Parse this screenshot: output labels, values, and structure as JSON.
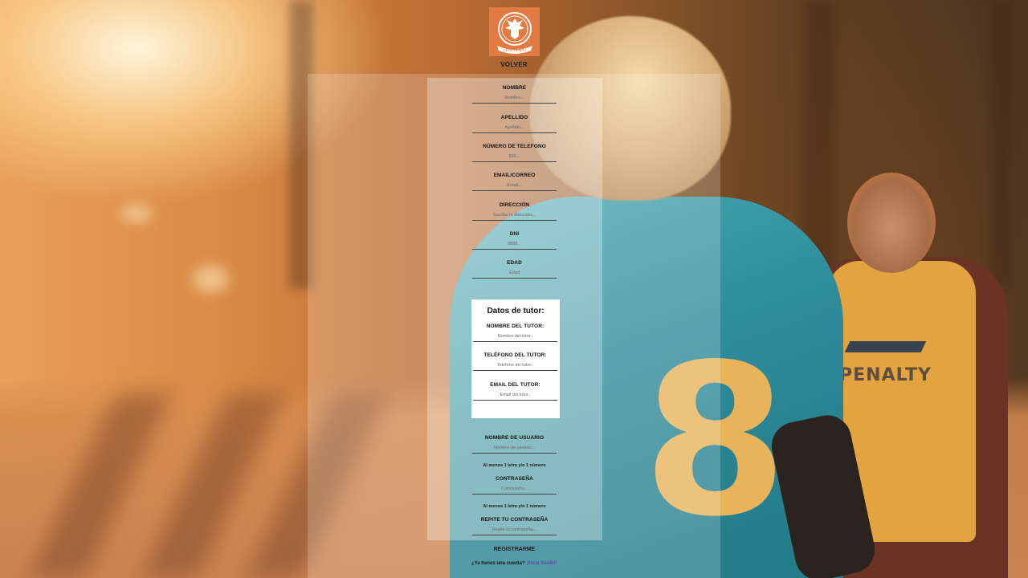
{
  "header": {
    "logo_icon": "club-henry-eagle-crest-icon",
    "logo_text": "CLUB HENRY",
    "back_label": "VOLVER",
    "logo_color": "#e17b43"
  },
  "form": {
    "fields": [
      {
        "label": "NOMBRE",
        "placeholder": "Nombre..."
      },
      {
        "label": "APELLIDO",
        "placeholder": "Apellido..."
      },
      {
        "label": "NÚMERO DE TELEFONO",
        "placeholder": "555..."
      },
      {
        "label": "EMAIL/CORREO",
        "placeholder": "Email..."
      },
      {
        "label": "DIRECCIÓN",
        "placeholder": "Escribe tu dirección..."
      },
      {
        "label": "DNI",
        "placeholder": "8888..."
      },
      {
        "label": "EDAD",
        "placeholder": "Edad"
      }
    ],
    "tutor": {
      "title": "Datos de tutor:",
      "fields": [
        {
          "label": "NOMBRE DEL TUTOR:",
          "placeholder": "Nombre del tutor.."
        },
        {
          "label": "TELÉFONO DEL TUTOR:",
          "placeholder": "Telefono del tutor.."
        },
        {
          "label": "EMAIL DEL TUTOR:",
          "placeholder": "Email del tutor.."
        }
      ]
    },
    "account": {
      "username_label": "NOMBRE DE USUARIO",
      "username_placeholder": "Nombre de usuario...",
      "username_hint": "Al menos 1 letra y/o 1 número",
      "password_label": "CONTRASEÑA",
      "password_placeholder": "Contraseña...",
      "password_hint": "Al menos 1 letra y/o 1 número",
      "repeat_label": "REPITE TU CONTRASEÑA",
      "repeat_placeholder": "Repite tu contraseña..."
    },
    "submit_label": "REGISTRARME",
    "login_prompt": "¿Ya tienes una cuenta?",
    "login_link": "¡Inicia Sesión!",
    "link_color": "#5a2fa8"
  },
  "background": {
    "shirt_number": "8",
    "vest_brand": "PENALTY"
  }
}
